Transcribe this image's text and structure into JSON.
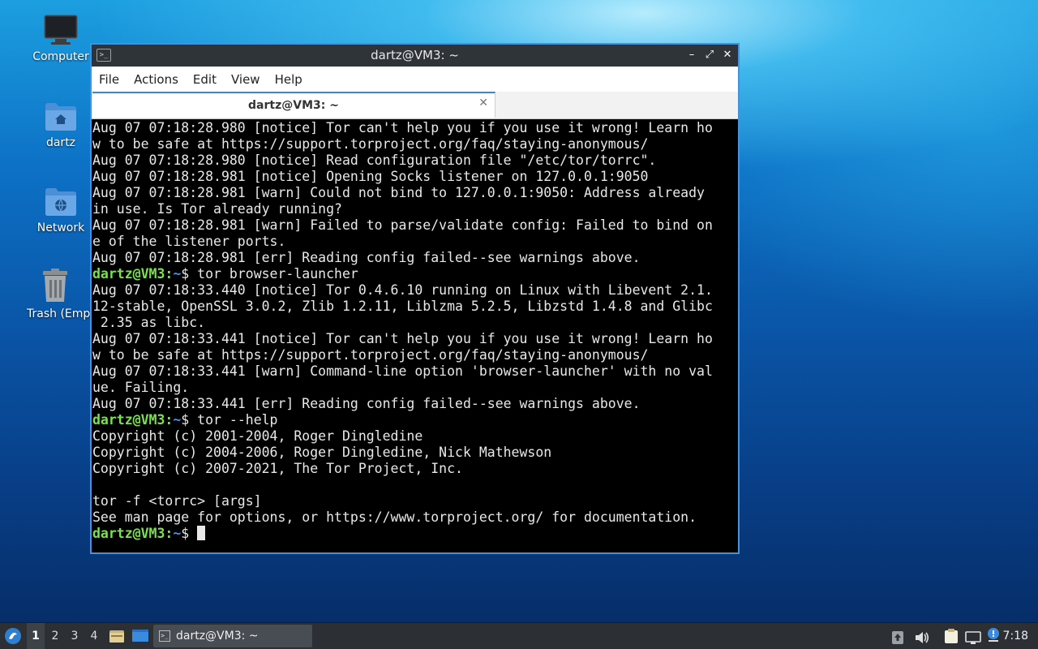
{
  "desktop": {
    "icons": [
      {
        "label": "Computer",
        "icon": "computer-icon"
      },
      {
        "label": "dartz",
        "icon": "home-folder-icon"
      },
      {
        "label": "Network",
        "icon": "network-folder-icon"
      },
      {
        "label": "Trash (Empty)",
        "icon": "trash-icon"
      }
    ]
  },
  "window": {
    "title": "dartz@VM3: ~",
    "controls": {
      "minimize": "–",
      "maximize": "⤢",
      "close": "✕"
    },
    "menu": [
      "File",
      "Actions",
      "Edit",
      "View",
      "Help"
    ],
    "tab": {
      "label": "dartz@VM3: ~",
      "close": "✕"
    }
  },
  "terminal": {
    "prompt_user": "dartz@VM3",
    "prompt_sep": ":",
    "prompt_path": "~",
    "prompt_end": "$",
    "lines": [
      {
        "type": "out",
        "text": "Aug 07 07:18:28.980 [notice] Tor can't help you if you use it wrong! Learn ho"
      },
      {
        "type": "out",
        "text": "w to be safe at https://support.torproject.org/faq/staying-anonymous/"
      },
      {
        "type": "out",
        "text": "Aug 07 07:18:28.980 [notice] Read configuration file \"/etc/tor/torrc\"."
      },
      {
        "type": "out",
        "text": "Aug 07 07:18:28.981 [notice] Opening Socks listener on 127.0.0.1:9050"
      },
      {
        "type": "out",
        "text": "Aug 07 07:18:28.981 [warn] Could not bind to 127.0.0.1:9050: Address already"
      },
      {
        "type": "out",
        "text": "in use. Is Tor already running?"
      },
      {
        "type": "out",
        "text": "Aug 07 07:18:28.981 [warn] Failed to parse/validate config: Failed to bind on"
      },
      {
        "type": "out",
        "text": "e of the listener ports."
      },
      {
        "type": "out",
        "text": "Aug 07 07:18:28.981 [err] Reading config failed--see warnings above."
      },
      {
        "type": "cmd",
        "text": " tor browser-launcher"
      },
      {
        "type": "out",
        "text": "Aug 07 07:18:33.440 [notice] Tor 0.4.6.10 running on Linux with Libevent 2.1."
      },
      {
        "type": "out",
        "text": "12-stable, OpenSSL 3.0.2, Zlib 1.2.11, Liblzma 5.2.5, Libzstd 1.4.8 and Glibc"
      },
      {
        "type": "out",
        "text": " 2.35 as libc."
      },
      {
        "type": "out",
        "text": "Aug 07 07:18:33.441 [notice] Tor can't help you if you use it wrong! Learn ho"
      },
      {
        "type": "out",
        "text": "w to be safe at https://support.torproject.org/faq/staying-anonymous/"
      },
      {
        "type": "out",
        "text": "Aug 07 07:18:33.441 [warn] Command-line option 'browser-launcher' with no val"
      },
      {
        "type": "out",
        "text": "ue. Failing."
      },
      {
        "type": "out",
        "text": "Aug 07 07:18:33.441 [err] Reading config failed--see warnings above."
      },
      {
        "type": "cmd",
        "text": " tor --help"
      },
      {
        "type": "out",
        "text": "Copyright (c) 2001-2004, Roger Dingledine"
      },
      {
        "type": "out",
        "text": "Copyright (c) 2004-2006, Roger Dingledine, Nick Mathewson"
      },
      {
        "type": "out",
        "text": "Copyright (c) 2007-2021, The Tor Project, Inc."
      },
      {
        "type": "out",
        "text": ""
      },
      {
        "type": "out",
        "text": "tor -f <torrc> [args]"
      },
      {
        "type": "out",
        "text": "See man page for options, or https://www.torproject.org/ for documentation."
      },
      {
        "type": "cursor",
        "text": " "
      }
    ]
  },
  "taskbar": {
    "workspaces": [
      "1",
      "2",
      "3",
      "4"
    ],
    "active_workspace": "1",
    "task_label": "dartz@VM3: ~",
    "clock": "7:18"
  },
  "colors": {
    "prompt_user": "#7be24a",
    "prompt_path": "#4d8bf0",
    "window_border": "#4a8fd8"
  }
}
